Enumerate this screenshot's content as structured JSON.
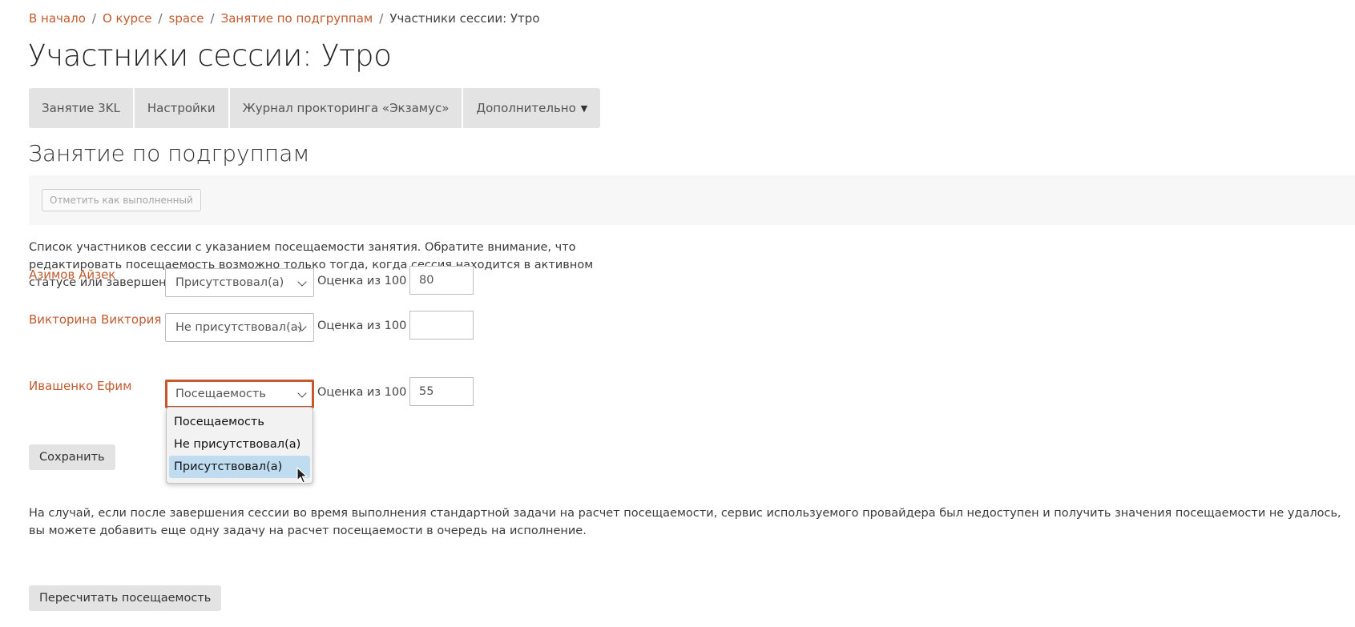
{
  "breadcrumb": {
    "items": [
      "В начало",
      "О курсе",
      "space",
      "Занятие по подгруппам"
    ],
    "current": "Участники сессии: Утро",
    "separator": "/"
  },
  "page_title": "Участники сессии: Утро",
  "tabs": [
    {
      "label": "Занятие 3KL"
    },
    {
      "label": "Настройки"
    },
    {
      "label": "Журнал прокторинга «Экзамус»"
    },
    {
      "label": "Дополнительно",
      "has_dropdown": true
    }
  ],
  "section_title": "Занятие по подгруппам",
  "completion_button": "Отметить как выполненный",
  "description": "Список участников сессии с указанием посещаемости занятия. Обратите внимание, что редактировать посещаемость возможно только тогда, когда сессия находится в активном статусе или завершена.",
  "grade_label": "Оценка из 100",
  "participants": [
    {
      "name": "Азимов Айзек",
      "attendance": "Присутствовал(а)",
      "grade": "80"
    },
    {
      "name": "Викторина Виктория",
      "attendance": "Не присутствовал(а)",
      "grade": ""
    },
    {
      "name": "Ивашенко Ефим",
      "attendance": "Посещаемость",
      "grade": "55"
    }
  ],
  "dropdown": {
    "options": [
      "Посещаемость",
      "Не присутствовал(а)",
      "Присутствовал(а)"
    ],
    "highlighted_index": 2
  },
  "save_button": "Сохранить",
  "note": "На случай, если после завершения сессии во время выполнения стандартной задачи на расчет посещаемости, сервис используемого провайдера был недоступен и получить значения посещаемости не удалось, вы можете добавить еще одну задачу на расчет посещаемости в очередь на исполнение.",
  "recalc_button": "Пересчитать посещаемость",
  "colors": {
    "link": "#c25b30",
    "focus_border": "#c9572d",
    "tab_bg": "#e3e3e3",
    "option_highlight": "#bfdcf0"
  },
  "icons": {
    "dropdown_caret": "chevron-down-icon",
    "cursor": "mouse-pointer-icon"
  }
}
